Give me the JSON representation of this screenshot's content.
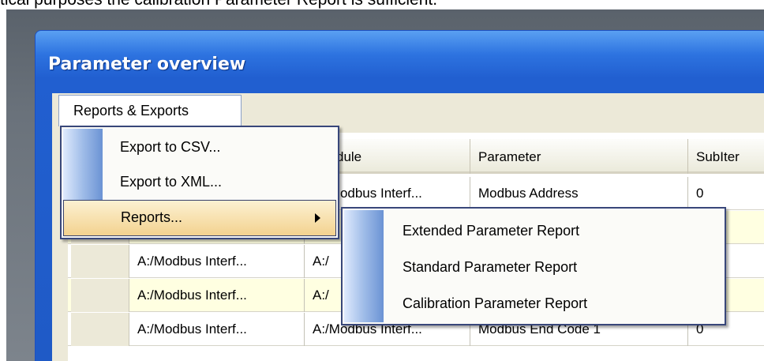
{
  "caption": "tical purposes the calibration Parameter Report is sufficient.",
  "window": {
    "title": "Parameter overview"
  },
  "menubar": {
    "active_menu": "Reports & Exports"
  },
  "menu": {
    "items": [
      {
        "label": "Export to CSV..."
      },
      {
        "label": "Export to XML..."
      },
      {
        "label": "Reports...",
        "has_submenu": true,
        "highlighted": true
      }
    ]
  },
  "submenu": {
    "items": [
      {
        "label": "Extended Parameter Report"
      },
      {
        "label": "Standard Parameter Report"
      },
      {
        "label": "Calibration Parameter Report"
      }
    ]
  },
  "grid": {
    "columns": [
      "dule",
      "Parameter",
      "SubIter"
    ],
    "rows": [
      {
        "col_a": "",
        "col_b": "A:/Modbus Interf...",
        "col_c": "Modbus Address",
        "col_d": "0"
      },
      {
        "col_a": "A:/Modbus Interf...",
        "col_b": "A:/",
        "col_c": "",
        "col_d": ""
      },
      {
        "col_a": "A:/Modbus Interf...",
        "col_b": "A:/",
        "col_c": "",
        "col_d": ""
      },
      {
        "col_a": "A:/Modbus Interf...",
        "col_b": "A:/Modbus Interf...",
        "col_c": "Modbus End Code 1",
        "col_d": "0"
      }
    ]
  },
  "colors": {
    "title_bar": "#215fd0",
    "menu_highlight": "#f3d28f",
    "row_highlight": "#ffffe1"
  }
}
